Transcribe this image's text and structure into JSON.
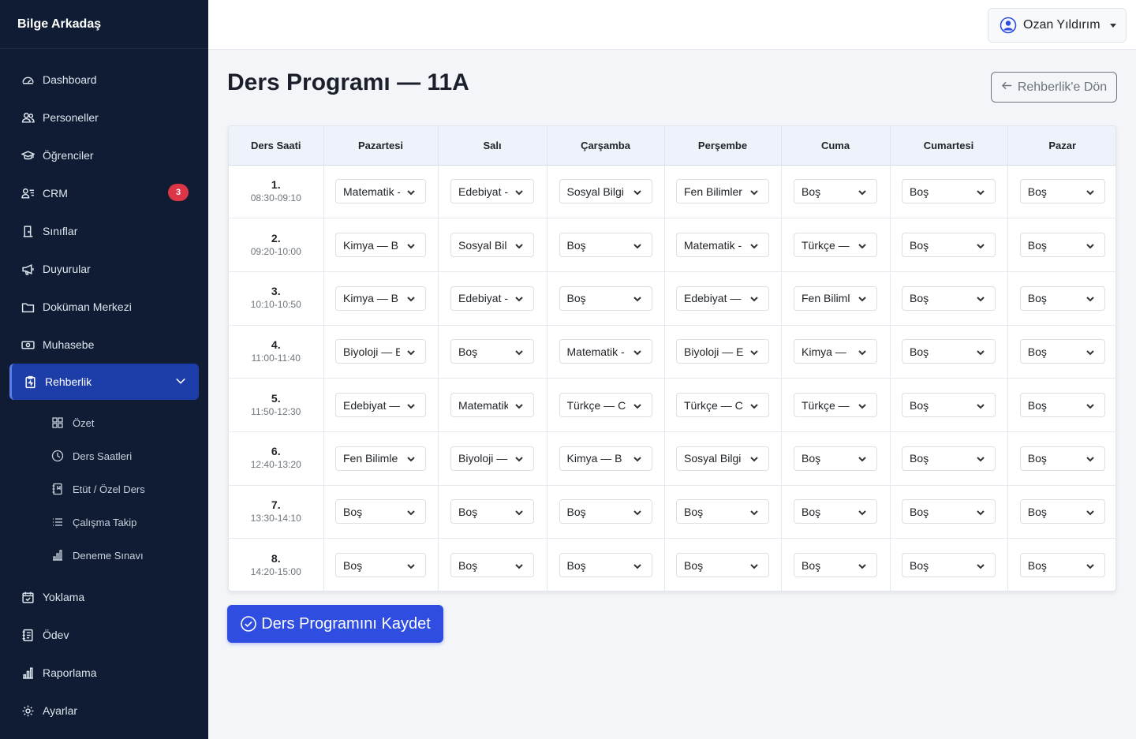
{
  "app": {
    "brand": "Bilge Arkadaş"
  },
  "sidebar": {
    "items": [
      {
        "label": "Dashboard",
        "icon": "dashboard-icon"
      },
      {
        "label": "Personeller",
        "icon": "users-icon"
      },
      {
        "label": "Öğrenciler",
        "icon": "graduation-cap-icon"
      },
      {
        "label": "CRM",
        "icon": "person-lines-icon",
        "badge": "3"
      },
      {
        "label": "Sınıflar",
        "icon": "door-icon"
      },
      {
        "label": "Duyurular",
        "icon": "megaphone-icon"
      },
      {
        "label": "Doküman Merkezi",
        "icon": "folder-icon"
      },
      {
        "label": "Muhasebe",
        "icon": "cash-icon"
      },
      {
        "label": "Rehberlik",
        "icon": "clipboard-pulse-icon",
        "active": true
      }
    ],
    "subitems": [
      {
        "label": "Özet",
        "icon": "grid-icon"
      },
      {
        "label": "Ders Saatleri",
        "icon": "clock-icon"
      },
      {
        "label": "Etüt / Özel Ders",
        "icon": "journal-icon"
      },
      {
        "label": "Çalışma Takip",
        "icon": "list-icon"
      },
      {
        "label": "Deneme Sınavı",
        "icon": "bar-chart-icon"
      }
    ],
    "items_after": [
      {
        "label": "Yoklama",
        "icon": "calendar-check-icon"
      },
      {
        "label": "Ödev",
        "icon": "journal-text-icon"
      },
      {
        "label": "Raporlama",
        "icon": "bar-chart-icon"
      },
      {
        "label": "Ayarlar",
        "icon": "gear-icon"
      }
    ]
  },
  "topbar": {
    "user_name": "Ozan Yıldırım"
  },
  "page": {
    "title": "Ders Programı — 11A",
    "back_label": "Rehberlik'e Dön",
    "save_label": "Ders Programını Kaydet"
  },
  "schedule": {
    "headers": [
      "Ders Saati",
      "Pazartesi",
      "Salı",
      "Çarşamba",
      "Perşembe",
      "Cuma",
      "Cumartesi",
      "Pazar"
    ],
    "rows": [
      {
        "num": "1.",
        "time": "08:30-09:10",
        "cells": [
          "Matematik -",
          "Edebiyat -",
          "Sosyal Bilgi",
          "Fen Bilimler",
          "Boş",
          "Boş",
          "Boş"
        ]
      },
      {
        "num": "2.",
        "time": "09:20-10:00",
        "cells": [
          "Kimya — B",
          "Sosyal Bil",
          "Boş",
          "Matematik -",
          "Türkçe —",
          "Boş",
          "Boş"
        ]
      },
      {
        "num": "3.",
        "time": "10:10-10:50",
        "cells": [
          "Kimya — B",
          "Edebiyat -",
          "Boş",
          "Edebiyat —",
          "Fen Biliml",
          "Boş",
          "Boş"
        ]
      },
      {
        "num": "4.",
        "time": "11:00-11:40",
        "cells": [
          "Biyoloji — E",
          "Boş",
          "Matematik -",
          "Biyoloji — E",
          "Kimya —",
          "Boş",
          "Boş"
        ]
      },
      {
        "num": "5.",
        "time": "11:50-12:30",
        "cells": [
          "Edebiyat —",
          "Matematik",
          "Türkçe — C",
          "Türkçe — C",
          "Türkçe —",
          "Boş",
          "Boş"
        ]
      },
      {
        "num": "6.",
        "time": "12:40-13:20",
        "cells": [
          "Fen Bilimle",
          "Biyoloji —",
          "Kimya — B",
          "Sosyal Bilgi",
          "Boş",
          "Boş",
          "Boş"
        ]
      },
      {
        "num": "7.",
        "time": "13:30-14:10",
        "cells": [
          "Boş",
          "Boş",
          "Boş",
          "Boş",
          "Boş",
          "Boş",
          "Boş"
        ]
      },
      {
        "num": "8.",
        "time": "14:20-15:00",
        "cells": [
          "Boş",
          "Boş",
          "Boş",
          "Boş",
          "Boş",
          "Boş",
          "Boş"
        ]
      }
    ]
  },
  "colors": {
    "sidebar_bg": "#0f1c33",
    "active_bg": "#1d3ea8",
    "primary": "#2f4de0",
    "badge": "#dc3545"
  }
}
